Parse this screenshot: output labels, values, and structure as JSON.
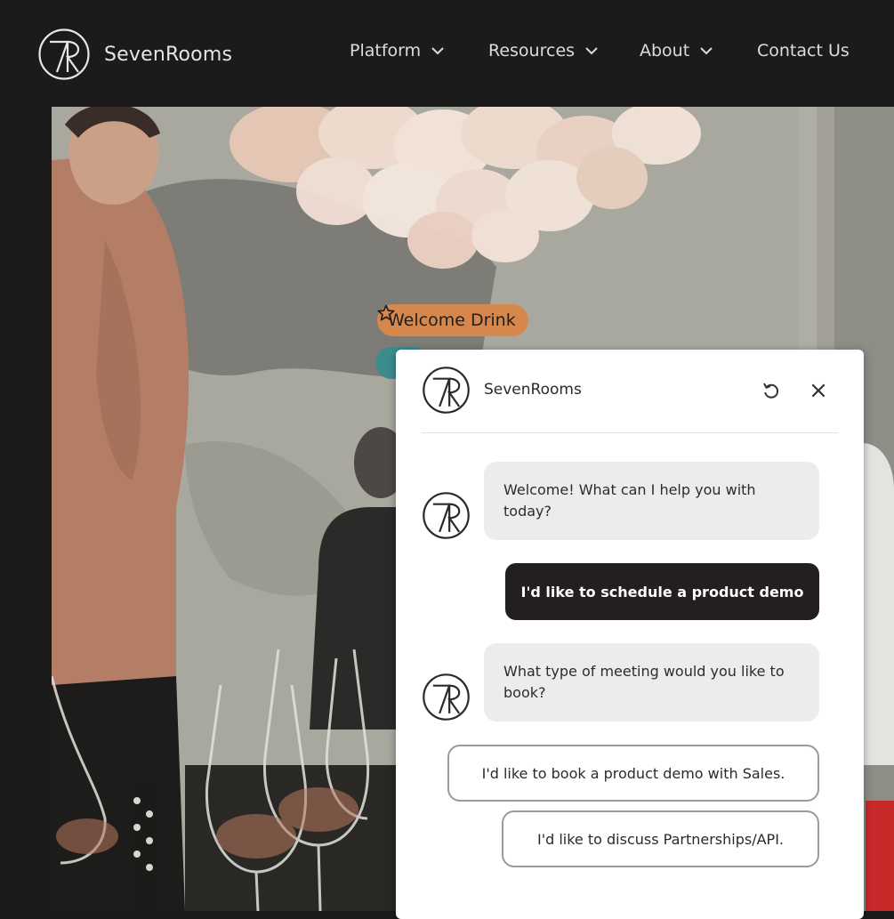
{
  "brand": {
    "name": "SevenRooms"
  },
  "nav": {
    "items": [
      {
        "label": "Platform"
      },
      {
        "label": "Resources"
      },
      {
        "label": "About"
      },
      {
        "label": "Contact Us"
      }
    ]
  },
  "hero": {
    "tag_label": "Welcome Drink",
    "tag_icon": "star-icon",
    "tag_color": "#d6884c",
    "tag2_color": "#3c8c8e"
  },
  "chat": {
    "title": "SevenRooms",
    "header_icons": [
      "refresh-icon",
      "close-icon"
    ],
    "messages": [
      {
        "from": "bot",
        "text": "Welcome! What can I help you with today?"
      },
      {
        "from": "user",
        "text": "I'd like to schedule a product demo"
      },
      {
        "from": "bot",
        "text": "What type of meeting would you like to book?"
      }
    ],
    "options": [
      {
        "label": "I'd like to book a product demo with Sales."
      },
      {
        "label": "I'd like to discuss Partnerships/API."
      }
    ]
  },
  "colors": {
    "background": "#1b1b1b",
    "user_bubble": "#231f1e",
    "bot_bubble": "#ececec"
  }
}
